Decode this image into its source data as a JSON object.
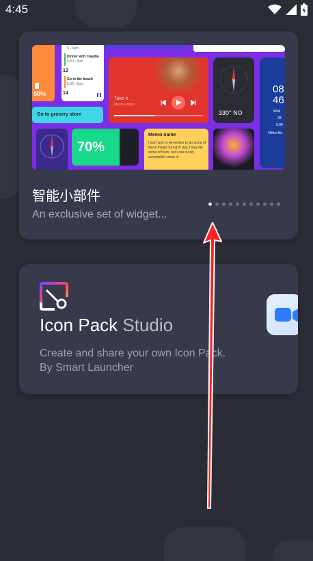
{
  "status_bar": {
    "time": "4:45"
  },
  "widgets_card": {
    "title": "智能小部件",
    "subtitle": "An exclusive set of widget...",
    "page_count": 11,
    "active_page": 0,
    "preview": {
      "battery_percent": "50%",
      "grocery_label": "Go to grocery store",
      "schedule": [
        {
          "text": "5 - 6pm"
        },
        {
          "text": "Dinner with Claudia"
        },
        {
          "text": "6:30 - 8pm"
        },
        {
          "text": "13"
        },
        {
          "text": "Go to the beach"
        },
        {
          "text": "6:30 - 8pm"
        },
        {
          "text": "14"
        }
      ],
      "music": {
        "song": "Take it",
        "artist": "Moon Empire"
      },
      "compass_readout": "330° NO",
      "big_percent": "70%",
      "memo": {
        "title": "Memo name",
        "body": "I just have to remember to do some of these things during th day. I may fall some of them, but I can surely accomplish some of"
      },
      "clock": {
        "hours": "08",
        "minutes": "46",
        "day": "Wed",
        "weather": "28",
        "alarm": "6:00",
        "office": "Office Me"
      }
    }
  },
  "iconpack_card": {
    "title_bold": "Icon Pack",
    "title_light": "Studio",
    "description_line1": "Create and share your own Icon Pack.",
    "description_line2": "By Smart Launcher"
  },
  "colors": {
    "background": "#2b2d36",
    "card": "#363a4b",
    "arrow": "#ff2222"
  }
}
